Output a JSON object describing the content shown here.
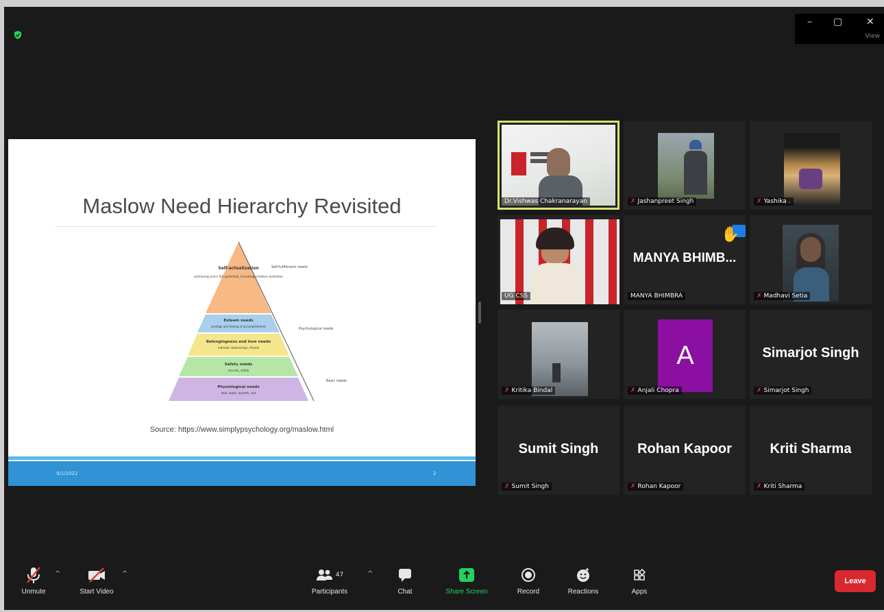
{
  "window": {
    "minimize": "–",
    "maximize": "▢",
    "close": "✕",
    "view_label": "View"
  },
  "slide": {
    "title": "Maslow Need Hierarchy Revisited",
    "source": "Source: https://www.simplypsychology.org/maslow.html",
    "footer_left": "9/1/2022",
    "footer_right": "2",
    "pyramid": {
      "levels": [
        {
          "label": "Self-actualization",
          "sub": "achieving one's full potential, including creative activities",
          "color": "#f8b985"
        },
        {
          "label": "Esteem needs",
          "sub": "prestige and feeling of accomplishment",
          "color": "#a9cfec"
        },
        {
          "label": "Belongingness and love needs",
          "sub": "intimate relationships, friends",
          "color": "#f4e68a"
        },
        {
          "label": "Safety needs",
          "sub": "security, safety",
          "color": "#b5e6a6"
        },
        {
          "label": "Physiological needs",
          "sub": "food, water, warmth, rest",
          "color": "#cfb5e3"
        }
      ],
      "side_labels": [
        "Self-fulfillment needs",
        "Psychological needs",
        "Basic needs"
      ]
    }
  },
  "participants": [
    {
      "display": "Dr.Vishwas Chakranarayan",
      "label": "Dr.Vishwas Chakranarayan",
      "muted": false,
      "type": "video",
      "active": true
    },
    {
      "display": "Jashanpreet Singh",
      "label": "Jashanpreet Singh",
      "muted": true,
      "type": "video"
    },
    {
      "display": "Yashika .",
      "label": "Yashika .",
      "muted": true,
      "type": "video"
    },
    {
      "display": "UG CSS",
      "label": "UG CSS",
      "muted": false,
      "type": "video"
    },
    {
      "display": "MANYA BHIMB...",
      "label": "MANYA BHIMBRA",
      "muted": false,
      "type": "name"
    },
    {
      "display": "Madhavi Setia",
      "label": "Madhavi Setia",
      "muted": true,
      "type": "video"
    },
    {
      "display": "Kritika Bindal",
      "label": "Kritika Bindal",
      "muted": true,
      "type": "video"
    },
    {
      "display": "A",
      "label": "Anjali Chopra",
      "muted": true,
      "type": "avatar"
    },
    {
      "display": "Simarjot Singh",
      "label": "Simarjot Singh",
      "muted": true,
      "type": "name"
    },
    {
      "display": "Sumit Singh",
      "label": "Sumit Singh",
      "muted": true,
      "type": "name"
    },
    {
      "display": "Rohan Kapoor",
      "label": "Rohan Kapoor",
      "muted": true,
      "type": "name"
    },
    {
      "display": "Kriti Sharma",
      "label": "Kriti Sharma",
      "muted": true,
      "type": "name"
    }
  ],
  "toolbar": {
    "unmute": "Unmute",
    "start_video": "Start Video",
    "participants": "Participants",
    "participant_count": "47",
    "chat": "Chat",
    "share_screen": "Share Screen",
    "record": "Record",
    "reactions": "Reactions",
    "apps": "Apps",
    "leave": "Leave"
  },
  "colors": {
    "accent_green": "#23d160",
    "leave_red": "#d9282f",
    "active_speaker": "#d9e46a",
    "muted_red": "#e0393e"
  }
}
